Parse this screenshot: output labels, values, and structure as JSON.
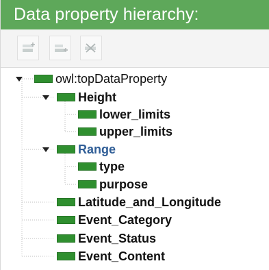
{
  "panel": {
    "title": "Data property hierarchy:"
  },
  "toolbar": {
    "buttons": [
      {
        "name": "add-subproperty-button",
        "icon": "add-subproperty-icon"
      },
      {
        "name": "add-sibling-property-button",
        "icon": "add-sibling-property-icon"
      },
      {
        "name": "delete-property-button",
        "icon": "delete-property-icon"
      }
    ]
  },
  "tree": {
    "root": "owl:topDataProperty",
    "height": "Height",
    "height_children": [
      "lower_limits",
      "upper_limits"
    ],
    "range": "Range",
    "range_children": [
      "type",
      "purpose"
    ],
    "other_children": [
      "Latitude_and_Longitude",
      "Event_Category",
      "Event_Status",
      "Event_Content"
    ]
  },
  "colors": {
    "header_bg": "#5ea85a",
    "node_icon": "#2f8f2f",
    "selected_text": "#2f5d96"
  }
}
